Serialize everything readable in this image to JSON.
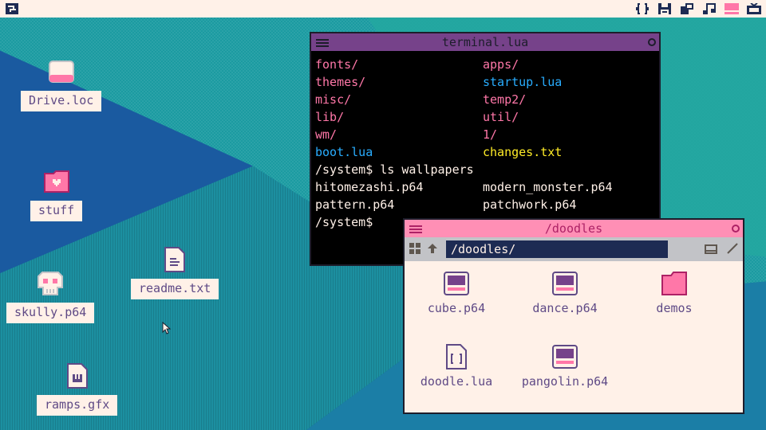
{
  "menubar": {
    "left_icon": "logo-icon",
    "tray_icons": [
      "code-icon",
      "save-icon",
      "windows-icon",
      "music-icon",
      "paint-icon",
      "tv-icon"
    ]
  },
  "desktop": {
    "items": [
      {
        "label": "Drive.loc",
        "icon": "drive-icon"
      },
      {
        "label": "stuff",
        "icon": "heart-folder-icon"
      },
      {
        "label": "readme.txt",
        "icon": "text-file-icon"
      },
      {
        "label": "skully.p64",
        "icon": "skull-icon"
      },
      {
        "label": "ramps.gfx",
        "icon": "gfx-file-icon"
      }
    ]
  },
  "terminal": {
    "title": "terminal.lua",
    "rows": [
      [
        {
          "text": "fonts/",
          "color": "#ff77a8"
        },
        {
          "text": "apps/",
          "color": "#ff77a8"
        }
      ],
      [
        {
          "text": "themes/",
          "color": "#ff77a8"
        },
        {
          "text": "startup.lua",
          "color": "#29adff"
        }
      ],
      [
        {
          "text": "misc/",
          "color": "#ff77a8"
        },
        {
          "text": "temp2/",
          "color": "#ff77a8"
        }
      ],
      [
        {
          "text": "lib/",
          "color": "#ff77a8"
        },
        {
          "text": "util/",
          "color": "#ff77a8"
        }
      ],
      [
        {
          "text": "wm/",
          "color": "#ff77a8"
        },
        {
          "text": "1/",
          "color": "#ff77a8"
        }
      ],
      [
        {
          "text": "boot.lua",
          "color": "#29adff"
        },
        {
          "text": "changes.txt",
          "color": "#ffec27"
        }
      ],
      [
        {
          "text": "/system$ ls wallpapers",
          "color": "#fff1e8"
        },
        {
          "text": "",
          "color": "#fff1e8"
        }
      ],
      [
        {
          "text": "hitomezashi.p64",
          "color": "#fff1e8"
        },
        {
          "text": "modern_monster.p64",
          "color": "#fff1e8"
        }
      ],
      [
        {
          "text": "pattern.p64",
          "color": "#fff1e8"
        },
        {
          "text": "patchwork.p64",
          "color": "#fff1e8"
        }
      ],
      [
        {
          "text": "/system$",
          "color": "#fff1e8"
        },
        {
          "text": "",
          "color": "#fff1e8"
        }
      ]
    ]
  },
  "filenav": {
    "title": "/doodles",
    "path_value": "/doodles/",
    "files": [
      {
        "label": "cube.p64",
        "icon": "cart-icon"
      },
      {
        "label": "dance.p64",
        "icon": "cart-icon"
      },
      {
        "label": "demos",
        "icon": "folder-icon"
      },
      {
        "label": "doodle.lua",
        "icon": "lua-file-icon"
      },
      {
        "label": "pangolin.p64",
        "icon": "cart-icon"
      }
    ]
  },
  "colors": {
    "cream": "#fff1e8",
    "purple": "#76428a",
    "pink": "#ff8fb5",
    "navy": "#1d2b53",
    "lavender": "#5f4a86"
  }
}
